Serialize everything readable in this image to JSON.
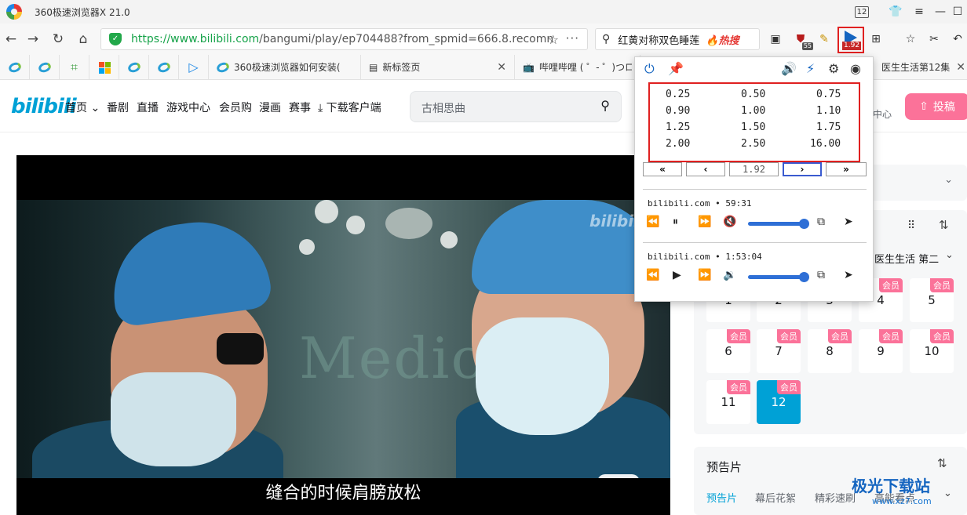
{
  "window": {
    "title": "360极速浏览器X 21.0",
    "tab_count": "12"
  },
  "address": {
    "url_main": "https://www.bilibili.com",
    "url_rest": "/bangumi/play/ep704488?from_spmid=666.8.recomn",
    "search_query": "红黄对称双色睡莲",
    "hot_label": "热搜",
    "ext_badge_55": "55",
    "speed_badge": "1.92"
  },
  "tabs": [
    {
      "label": "360极速浏览器如何安装("
    },
    {
      "label": "新标签页"
    },
    {
      "label": "哔哩哔哩 ( ゜- ゜)つロ 千"
    },
    {
      "label": "医生生活第12集"
    }
  ],
  "bili": {
    "logo": "bilibili",
    "nav": [
      "首页",
      "番剧",
      "直播",
      "游戏中心",
      "会员购",
      "漫画",
      "赛事",
      "下载客户端"
    ],
    "search_placeholder": "古相思曲",
    "upload": "投稿",
    "center": "中心"
  },
  "video": {
    "wall_text": "Medica",
    "corner_logo": "bilibili",
    "subtitle": "缝合的时候肩膀放松"
  },
  "series": {
    "title": "医生生活 第二",
    "episodes": [
      {
        "n": "4",
        "vip": "会员"
      },
      {
        "n": "5",
        "vip": "会员"
      },
      {
        "n": "6",
        "vip": "会员"
      },
      {
        "n": "7",
        "vip": "会员"
      },
      {
        "n": "8",
        "vip": "会员"
      },
      {
        "n": "9",
        "vip": "会员"
      },
      {
        "n": "10",
        "vip": "会员"
      },
      {
        "n": "11",
        "vip": "会员"
      },
      {
        "n": "12",
        "vip": "会员"
      }
    ],
    "hidden_nums": [
      "1",
      "2",
      "3"
    ]
  },
  "preview": {
    "title": "预告片",
    "tabs": [
      "预告片",
      "幕后花絮",
      "精彩速刷",
      "高能看点"
    ]
  },
  "popup": {
    "speeds": [
      [
        "0.25",
        "0.50",
        "0.75"
      ],
      [
        "0.90",
        "1.00",
        "1.10"
      ],
      [
        "1.25",
        "1.50",
        "1.75"
      ],
      [
        "2.00",
        "2.50",
        "16.00"
      ]
    ],
    "current_speed": "1.92",
    "media": [
      {
        "title": "bilibili.com • 59:31",
        "volume": 1.0,
        "state": "playing",
        "muted": true
      },
      {
        "title": "bilibili.com • 1:53:04",
        "volume": 1.0,
        "state": "paused",
        "muted": false
      }
    ]
  },
  "watermark": {
    "big": "极光下载站",
    "small": "www.xz7.com"
  },
  "colors": {
    "bili_blue": "#00a1d6",
    "bili_pink": "#fb7299",
    "highlight_red": "#e02020",
    "url_green": "#17a34a"
  }
}
